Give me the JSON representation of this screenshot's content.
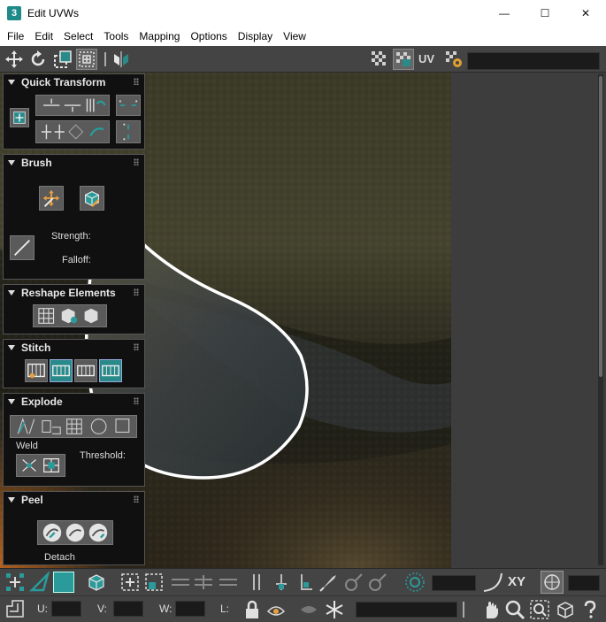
{
  "window": {
    "app_icon_text": "3",
    "title": "Edit UVWs",
    "minimize_glyph": "—",
    "maximize_glyph": "☐",
    "close_glyph": "✕"
  },
  "menu": [
    "File",
    "Edit",
    "Select",
    "Tools",
    "Mapping",
    "Options",
    "Display",
    "View"
  ],
  "toolbar": {
    "uv_label": "UV",
    "map_field_value": ""
  },
  "panel": {
    "quick_transform": {
      "title": "Quick Transform"
    },
    "brush": {
      "title": "Brush",
      "strength_label": "Strength:",
      "falloff_label": "Falloff:"
    },
    "reshape": {
      "title": "Reshape Elements"
    },
    "stitch": {
      "title": "Stitch"
    },
    "explode": {
      "title": "Explode",
      "weld_label": "Weld",
      "threshold_label": "Threshold:"
    },
    "peel": {
      "title": "Peel",
      "detach_label": "Detach"
    }
  },
  "bottom": {
    "xy_label": "XY",
    "u_label": "U:",
    "v_label": "V:",
    "w_label": "W:",
    "l_label": "L:",
    "u_value": "",
    "v_value": "",
    "w_value": "",
    "l_value": ""
  },
  "colors": {
    "accent": "#2a8a8a",
    "panel_bg": "#3d3d3d",
    "toolbar_bg": "#444444",
    "selection_outline": "#ffffff"
  }
}
